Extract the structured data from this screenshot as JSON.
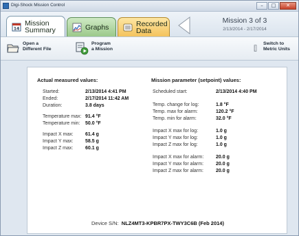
{
  "window": {
    "title": "Digi-Shock Mission Control",
    "buttons": {
      "minimize": "–",
      "maximize": "□",
      "close": "✕"
    }
  },
  "tabs": [
    {
      "label": "Mission Summary",
      "icon": "calendar-icon",
      "active": true
    },
    {
      "label": "Graphs",
      "icon": "graph-icon",
      "active": false
    },
    {
      "label": "Recorded Data",
      "icon": "data-icon",
      "active": false
    }
  ],
  "mission": {
    "title": "Mission 3 of 3",
    "dates": "2/13/2014 - 2/17/2014"
  },
  "toolbar": {
    "open_label": "Open a\nDifferent File",
    "program_label": "Program\na Mission",
    "metric_label": "Switch to\nMetric Units"
  },
  "actual": {
    "title": "Actual measured values:",
    "rows": [
      {
        "label": "Started:",
        "value": "2/13/2014 4:41 PM"
      },
      {
        "label": "Ended:",
        "value": "2/17/2014 11:42 AM"
      },
      {
        "label": "Duration:",
        "value": "3.8 days"
      },
      {
        "label": "Temperature max:",
        "value": "91.4 °F"
      },
      {
        "label": "Temperature min:",
        "value": "50.0 °F"
      },
      {
        "label": "Impact X max:",
        "value": "61.4 g"
      },
      {
        "label": "Impact Y max:",
        "value": "58.5 g"
      },
      {
        "label": "Impact Z max:",
        "value": "60.1 g"
      }
    ]
  },
  "setpoint": {
    "title": "Mission parameter (setpoint) values:",
    "rows": [
      {
        "label": "Scheduled start:",
        "value": "2/13/2014 4:40 PM"
      },
      {
        "label": "Temp. change for log:",
        "value": "1.8 °F"
      },
      {
        "label": "Temp. max for alarm:",
        "value": "120.2 °F"
      },
      {
        "label": "Temp. min for alarm:",
        "value": "32.0 °F"
      },
      {
        "label": "Impact X max for log:",
        "value": "1.0 g"
      },
      {
        "label": "Impact Y max for log:",
        "value": "1.0 g"
      },
      {
        "label": "Impact Z max for log:",
        "value": "1.0 g"
      },
      {
        "label": "Impact X max for alarm:",
        "value": "20.0 g"
      },
      {
        "label": "Impact Y max for alarm:",
        "value": "20.0 g"
      },
      {
        "label": "Impact Z max for alarm:",
        "value": "20.0 g"
      }
    ]
  },
  "device": {
    "label": "Device S/N:",
    "serial": "NLZ4MT3-KPBR7PX-TWY3C6B (Feb 2014)"
  }
}
